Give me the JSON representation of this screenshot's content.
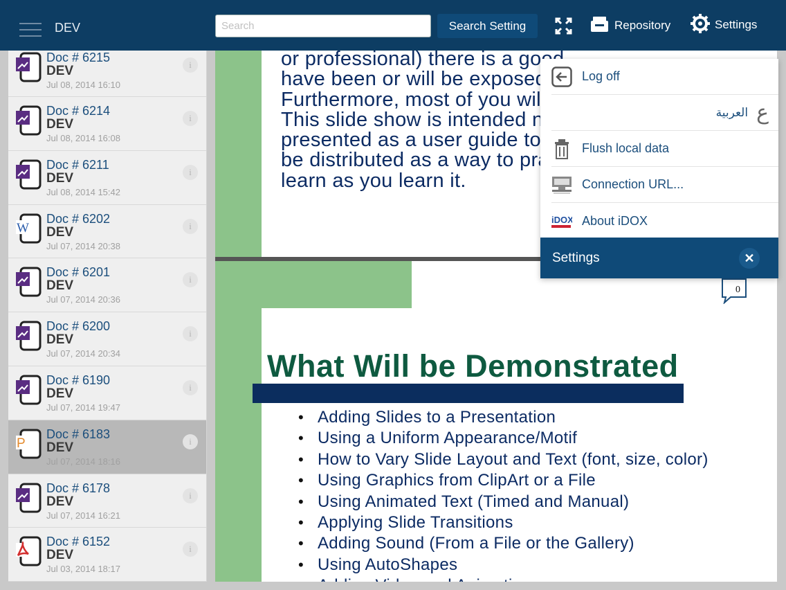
{
  "topbar": {
    "app_title": "DEV",
    "search_placeholder": "Search",
    "search_setting_label": "Search Setting",
    "repository_label": "Repository",
    "settings_label": "Settings",
    "bar_color": "#0d3d63"
  },
  "documents": [
    {
      "title": "Doc # 6215",
      "subtitle": "DEV",
      "date": "Jul 08, 2014 16:10",
      "type": "powerpoint-icon",
      "info": "i"
    },
    {
      "title": "Doc # 6214",
      "subtitle": "DEV",
      "date": "Jul 08, 2014 16:08",
      "type": "powerpoint-icon",
      "info": "i"
    },
    {
      "title": "Doc # 6211",
      "subtitle": "DEV",
      "date": "Jul 08, 2014 15:42",
      "type": "powerpoint-icon",
      "info": "i"
    },
    {
      "title": "Doc # 6202",
      "subtitle": "DEV",
      "date": "Jul 07, 2014 20:38",
      "type": "word-icon",
      "info": "i"
    },
    {
      "title": "Doc # 6201",
      "subtitle": "DEV",
      "date": "Jul 07, 2014 20:36",
      "type": "powerpoint-icon",
      "info": "i"
    },
    {
      "title": "Doc # 6200",
      "subtitle": "DEV",
      "date": "Jul 07, 2014 20:34",
      "type": "powerpoint-icon",
      "info": "i"
    },
    {
      "title": "Doc # 6190",
      "subtitle": "DEV",
      "date": "Jul 07, 2014 19:47",
      "type": "powerpoint-icon",
      "info": "i"
    },
    {
      "title": "Doc # 6183",
      "subtitle": "DEV",
      "date": "Jul 07, 2014 18:16",
      "type": "presentation-p-icon",
      "info": "i",
      "selected": true
    },
    {
      "title": "Doc # 6178",
      "subtitle": "DEV",
      "date": "Jul 07, 2014 16:21",
      "type": "powerpoint-icon",
      "info": "i"
    },
    {
      "title": "Doc # 6152",
      "subtitle": "DEV",
      "date": "Jul 03, 2014 18:17",
      "type": "pdf-icon",
      "info": "i"
    }
  ],
  "viewer": {
    "slide1_lines": [
      "or professional) there is a good",
      "have been or will be exposed to",
      "Furthermore, most of you will no",
      "This slide show is intended not",
      "presented as a user guide to Po",
      "be distributed as a way to pract",
      "learn as you learn it."
    ],
    "slide2": {
      "heading": "What Will be Demonstrated",
      "comment_count": "0",
      "bullets": [
        "Adding Slides to a Presentation",
        "Using a Uniform Appearance/Motif",
        "How to Vary Slide Layout and Text (font, size, color)",
        "Using Graphics from ClipArt or a File",
        "Using Animated Text (Timed and Manual)",
        "Applying Slide Transitions",
        "Adding Sound (From a File or the Gallery)",
        "Using AutoShapes",
        "Adding Video and Animation"
      ]
    }
  },
  "settings_menu": {
    "items": [
      {
        "label": "Log off",
        "icon": "logoff-icon"
      },
      {
        "label": "العربية",
        "icon": "arabic-language-icon"
      },
      {
        "label": "Flush local data",
        "icon": "trash-icon"
      },
      {
        "label": "Connection URL...",
        "icon": "server-icon"
      },
      {
        "label": "About iDOX",
        "icon": "idox-logo-icon"
      }
    ],
    "footer_title": "Settings",
    "close_label": "✕",
    "accent": "#0f4a78"
  }
}
